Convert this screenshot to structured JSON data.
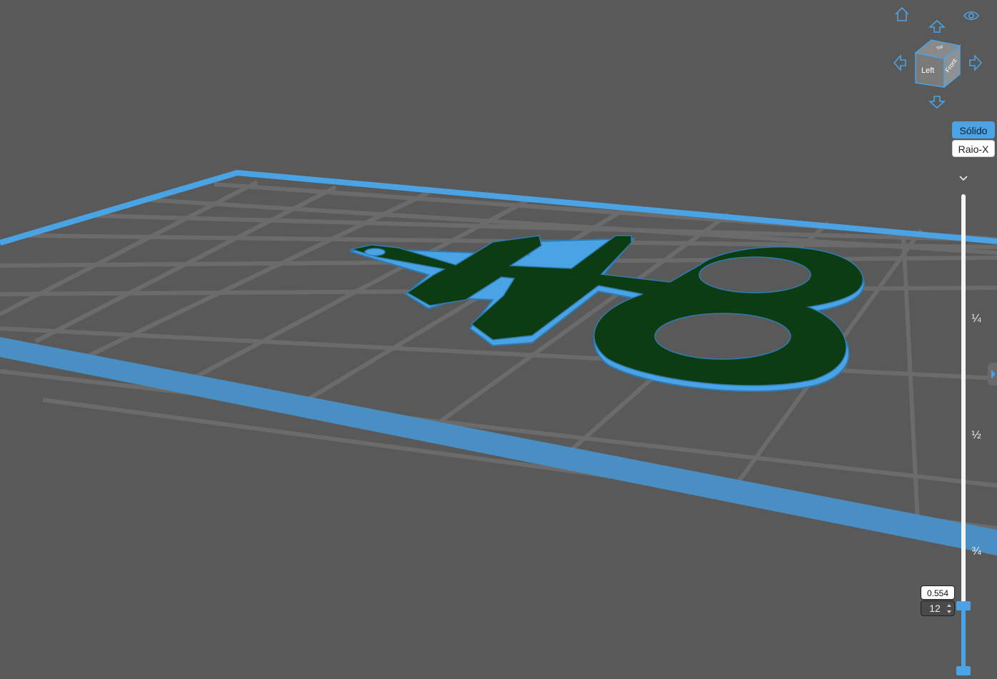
{
  "viewport": {
    "model_text": "H8",
    "colors": {
      "background": "#595959",
      "bed_border": "#4aa3e4",
      "grid_line": "#6b6b6b",
      "model_top": "#0e3c12",
      "model_side": "#4aa3e4"
    }
  },
  "navigation": {
    "home_icon": "home-icon",
    "visibility_icon": "eye-icon",
    "arrow_icons": [
      "arrow-up-icon",
      "arrow-left-icon",
      "arrow-right-icon",
      "arrow-down-icon"
    ],
    "view_cube": {
      "front_label": "Left",
      "side_label": "Front",
      "top_label": "Top"
    }
  },
  "render_mode": {
    "solid_label": "Sólido",
    "xray_label": "Raio-X",
    "selected": "Sólido"
  },
  "layer_slider": {
    "ticks": [
      "¼",
      "½",
      "¾"
    ],
    "height_value": "0.554",
    "layer_number": "12",
    "collapse_icon": "chevron-down-icon"
  },
  "side_panel": {
    "toggle_icon": "chevron-right-icon"
  }
}
